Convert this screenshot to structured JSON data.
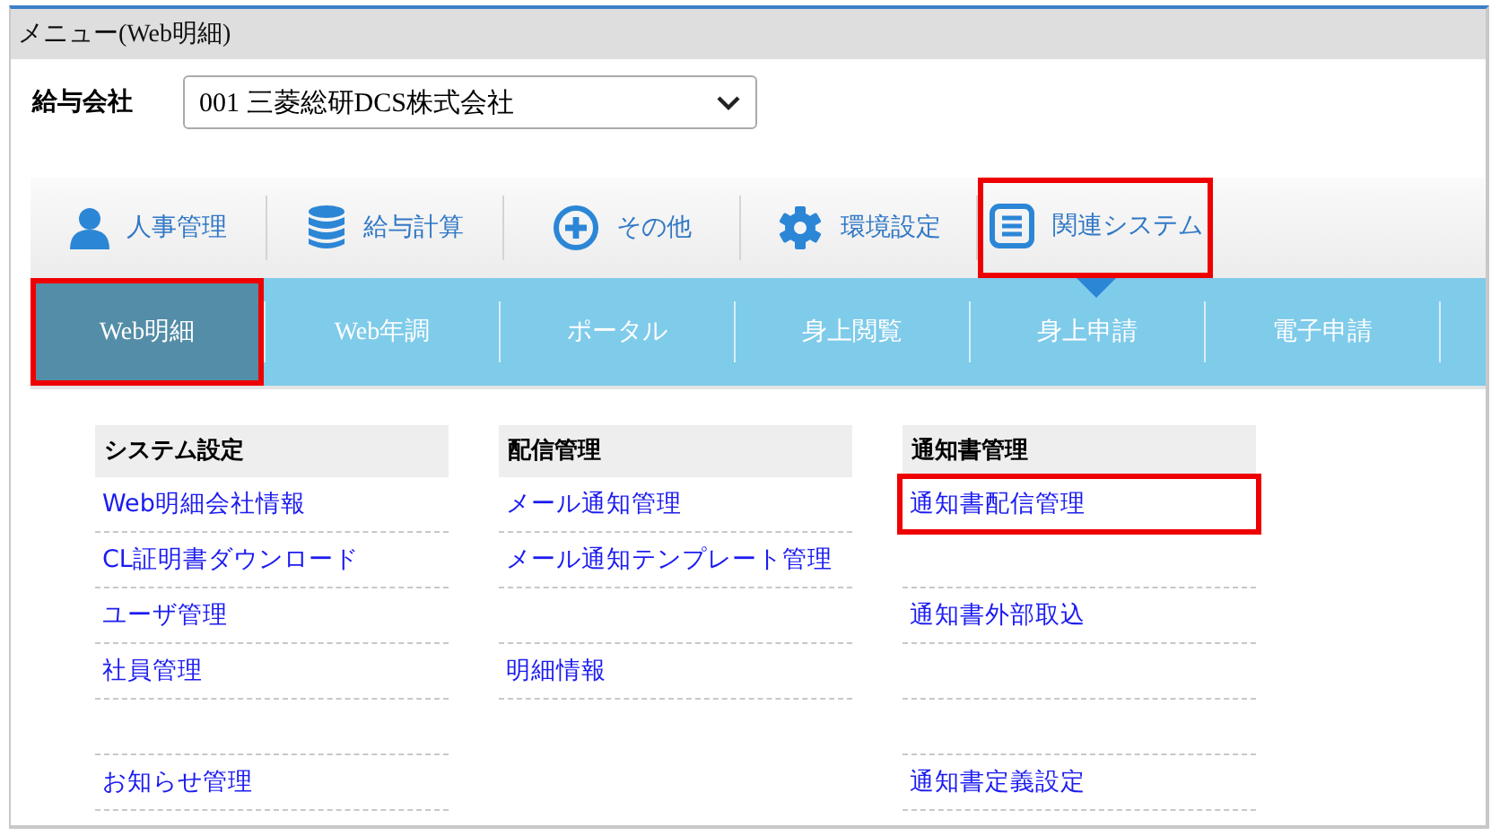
{
  "header": {
    "title": "メニュー(Web明細)"
  },
  "company": {
    "label": "給与会社",
    "value": "001 三菱総研DCS株式会社"
  },
  "top_nav": [
    {
      "label": "人事管理",
      "selected": false,
      "highlighted": false
    },
    {
      "label": "給与計算",
      "selected": false,
      "highlighted": false
    },
    {
      "label": "その他",
      "selected": false,
      "highlighted": false
    },
    {
      "label": "環境設定",
      "selected": false,
      "highlighted": false
    },
    {
      "label": "関連システム",
      "selected": true,
      "highlighted": true
    }
  ],
  "sub_tabs": [
    {
      "label": "Web明細",
      "selected": true,
      "highlighted": true
    },
    {
      "label": "Web年調",
      "selected": false,
      "highlighted": false
    },
    {
      "label": "ポータル",
      "selected": false,
      "highlighted": false
    },
    {
      "label": "身上閲覧",
      "selected": false,
      "highlighted": false
    },
    {
      "label": "身上申請",
      "selected": false,
      "highlighted": false
    },
    {
      "label": "電子申請",
      "selected": false,
      "highlighted": false
    }
  ],
  "menu_columns": [
    {
      "heading": "システム設定",
      "items": [
        {
          "kind": "link",
          "label": "Web明細会社情報",
          "highlighted": false
        },
        {
          "kind": "link",
          "label": "CL証明書ダウンロード",
          "highlighted": false
        },
        {
          "kind": "link",
          "label": "ユーザ管理",
          "highlighted": false
        },
        {
          "kind": "link",
          "label": "社員管理",
          "highlighted": false
        },
        {
          "kind": "blank"
        },
        {
          "kind": "link",
          "label": "お知らせ管理",
          "highlighted": false
        }
      ]
    },
    {
      "heading": "配信管理",
      "items": [
        {
          "kind": "link",
          "label": "メール通知管理",
          "highlighted": false
        },
        {
          "kind": "link",
          "label": "メール通知テンプレート管理",
          "highlighted": false
        },
        {
          "kind": "blank"
        },
        {
          "kind": "link",
          "label": "明細情報",
          "highlighted": false
        }
      ]
    },
    {
      "heading": "通知書管理",
      "items": [
        {
          "kind": "link",
          "label": "通知書配信管理",
          "highlighted": true
        },
        {
          "kind": "blank"
        },
        {
          "kind": "link",
          "label": "通知書外部取込",
          "highlighted": false
        },
        {
          "kind": "blank"
        },
        {
          "kind": "blank"
        },
        {
          "kind": "link",
          "label": "通知書定義設定",
          "highlighted": false
        }
      ]
    }
  ]
}
